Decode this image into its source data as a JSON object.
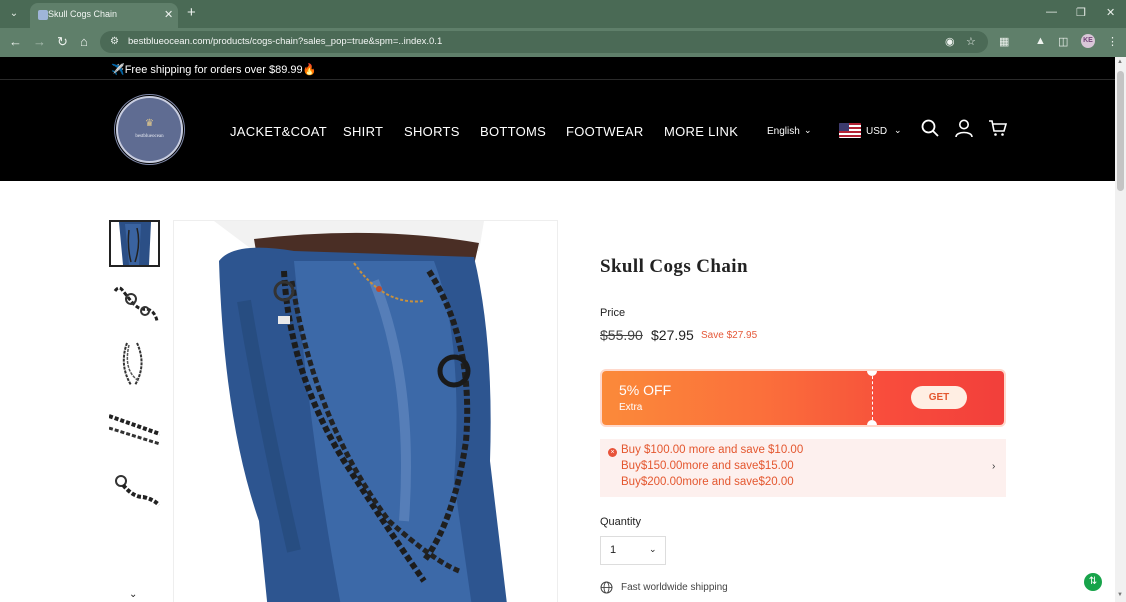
{
  "browser": {
    "tab_title": "Skull Cogs Chain",
    "url": "bestblueocean.com/products/cogs-chain?sales_pop=true&spm=..index.0.1",
    "profile_initials": "KE"
  },
  "announcement": "✈️Free shipping for orders over $89.99🔥",
  "header": {
    "logo_text": "bestblueocean",
    "nav": [
      "JACKET&COAT",
      "SHIRT",
      "SHORTS",
      "BOTTOMS",
      "FOOTWEAR",
      "MORE LINK"
    ],
    "language": "English",
    "currency": "USD"
  },
  "product": {
    "title": "Skull Cogs Chain",
    "price_label": "Price",
    "price_old": "$55.90",
    "price_new": "$27.95",
    "save": "Save $27.95",
    "coupon": {
      "percent": "5% OFF",
      "extra": "Extra",
      "get_label": "GET"
    },
    "tiers": [
      "Buy $100.00 more and save $10.00",
      "Buy$150.00more and save$15.00",
      "Buy$200.00more and save$20.00"
    ],
    "quantity_label": "Quantity",
    "quantity_value": "1",
    "shipping": "Fast worldwide shipping"
  },
  "colors": {
    "accent": "#e4572f",
    "coupon_start": "#fb8a3a",
    "coupon_end": "#f23f3b",
    "header_bg": "#000000",
    "chrome_bg": "#5f7f6a"
  }
}
